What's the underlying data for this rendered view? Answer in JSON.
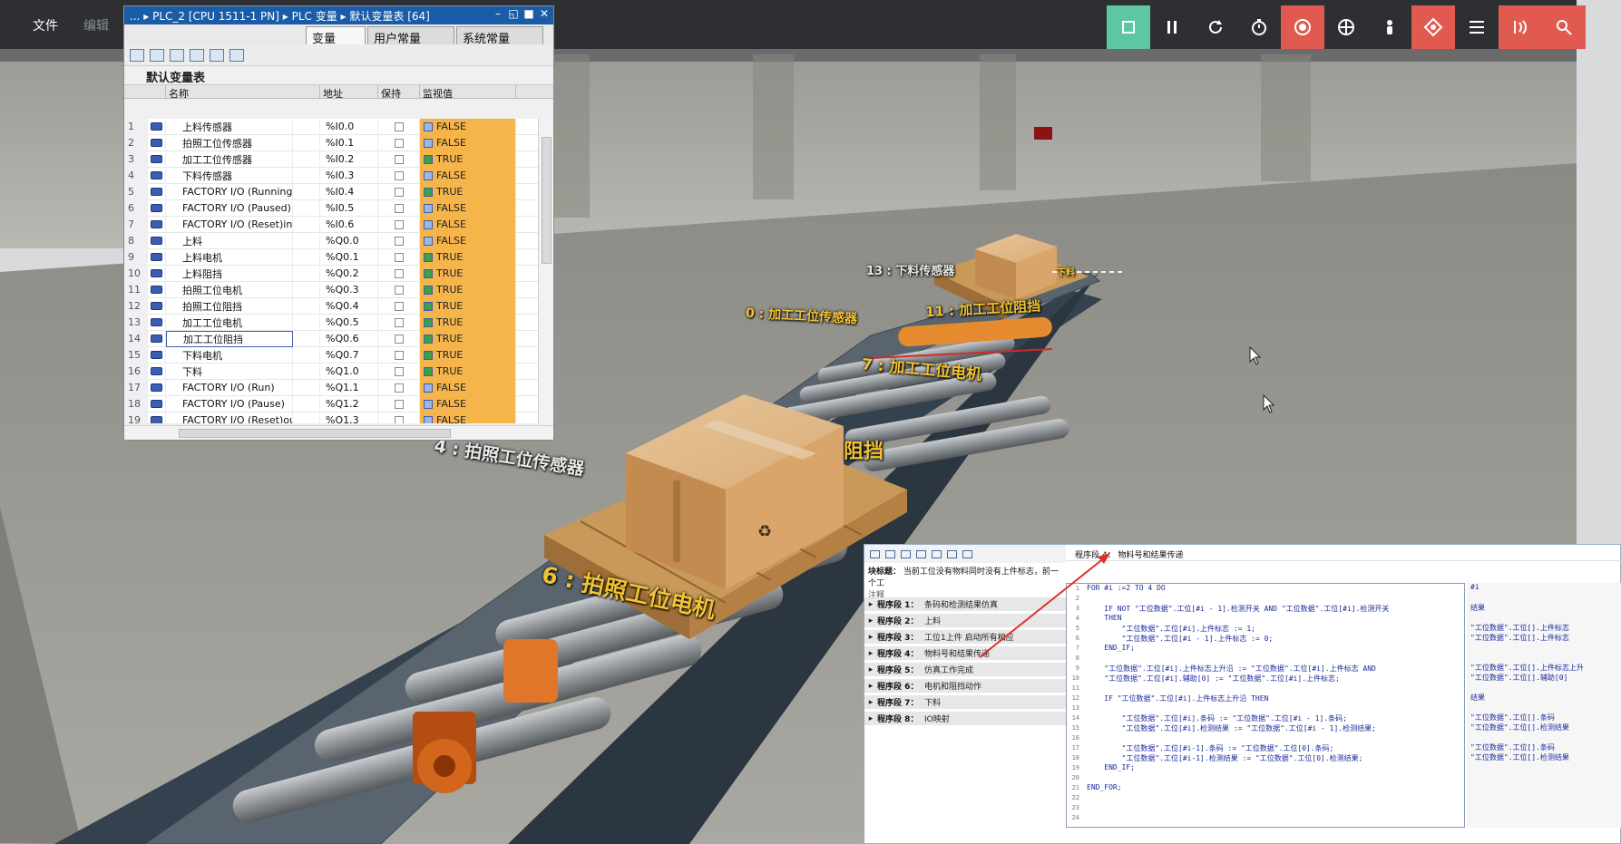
{
  "app": {
    "menu": [
      "文件",
      "编辑"
    ]
  },
  "toolbar": {
    "buttons": [
      {
        "icon": "stop-icon",
        "color": "#5cc7a2"
      },
      {
        "icon": "pause-icon",
        "color": "#2d2f33"
      },
      {
        "icon": "reset-icon",
        "color": "#2d2f33"
      },
      {
        "icon": "timer-icon",
        "color": "#2d2f33"
      },
      {
        "icon": "camera-orbit-icon",
        "color": "#e05a4f"
      },
      {
        "icon": "camera-fly-icon",
        "color": "#2d2f33"
      },
      {
        "icon": "camera-first-person-icon",
        "color": "#2d2f33"
      },
      {
        "icon": "sensor-icon",
        "color": "#e05a4f"
      },
      {
        "icon": "list-icon",
        "color": "#2d2f33"
      },
      {
        "icon": "drivers-icon",
        "color": "#e05a4f"
      },
      {
        "icon": "settings-icon",
        "color": "#e05a4f"
      }
    ]
  },
  "scene_labels": {
    "l13": "13 : 下料传感器",
    "l0": "0 : 加工工位传感器",
    "l11": "11 : 加工工位阻挡",
    "l7": "7 : 加工工位电机",
    "l4": "4 : 拍照工位传感器",
    "l6": "6 : 拍照工位电机",
    "lzd": "阻挡",
    "lxl": "下料"
  },
  "tag_window": {
    "title": "... ▸ PLC_2 [CPU 1511-1 PN] ▸ PLC 变量 ▸ 默认变量表 [64]",
    "tabs": [
      "变量",
      "用户常量",
      "系统常量"
    ],
    "table_title": "默认变量表",
    "columns": [
      "",
      "名称",
      "地址",
      "保持",
      "监视值"
    ],
    "rows": [
      {
        "num": "1",
        "name": "上料传感器",
        "addr": "%I0.0",
        "value": "FALSE"
      },
      {
        "num": "2",
        "name": "拍照工位传感器",
        "addr": "%I0.1",
        "value": "FALSE"
      },
      {
        "num": "3",
        "name": "加工工位传感器",
        "addr": "%I0.2",
        "value": "TRUE"
      },
      {
        "num": "4",
        "name": "下料传感器",
        "addr": "%I0.3",
        "value": "FALSE"
      },
      {
        "num": "5",
        "name": "FACTORY I/O (Running)",
        "addr": "%I0.4",
        "value": "TRUE"
      },
      {
        "num": "6",
        "name": "FACTORY I/O (Paused)",
        "addr": "%I0.5",
        "value": "FALSE"
      },
      {
        "num": "7",
        "name": "FACTORY I/O (Reset)in",
        "addr": "%I0.6",
        "value": "FALSE"
      },
      {
        "num": "8",
        "name": "上料",
        "addr": "%Q0.0",
        "value": "FALSE"
      },
      {
        "num": "9",
        "name": "上料电机",
        "addr": "%Q0.1",
        "value": "TRUE"
      },
      {
        "num": "10",
        "name": "上料阻挡",
        "addr": "%Q0.2",
        "value": "TRUE"
      },
      {
        "num": "11",
        "name": "拍照工位电机",
        "addr": "%Q0.3",
        "value": "TRUE"
      },
      {
        "num": "12",
        "name": "拍照工位阻挡",
        "addr": "%Q0.4",
        "value": "TRUE"
      },
      {
        "num": "13",
        "name": "加工工位电机",
        "addr": "%Q0.5",
        "value": "TRUE"
      },
      {
        "num": "14",
        "name": "加工工位阻挡",
        "addr": "%Q0.6",
        "value": "TRUE"
      },
      {
        "num": "15",
        "name": "下料电机",
        "addr": "%Q0.7",
        "value": "TRUE"
      },
      {
        "num": "16",
        "name": "下料",
        "addr": "%Q1.0",
        "value": "TRUE"
      },
      {
        "num": "17",
        "name": "FACTORY I/O (Run)",
        "addr": "%Q1.1",
        "value": "FALSE"
      },
      {
        "num": "18",
        "name": "FACTORY I/O (Pause)",
        "addr": "%Q1.2",
        "value": "FALSE"
      },
      {
        "num": "19",
        "name": "FACTORY I/O (Reset)out",
        "addr": "%Q1.3",
        "value": "FALSE"
      }
    ],
    "selected_row": "14"
  },
  "program": {
    "block_label": "块标题：",
    "block_desc": "当前工位没有物料同时没有上件标志，前一个工",
    "comment": "注释",
    "segments": [
      {
        "no": "程序段 1：",
        "desc": "条码和检测结果仿真"
      },
      {
        "no": "程序段 2：",
        "desc": "上料"
      },
      {
        "no": "程序段 3：",
        "desc": "工位1上件 启动所有相应"
      },
      {
        "no": "程序段 4：",
        "desc": "物料号和结果传递"
      },
      {
        "no": "程序段 5：",
        "desc": "仿真工作完成"
      },
      {
        "no": "程序段 6：",
        "desc": "电机和阻挡动作"
      },
      {
        "no": "程序段 7：",
        "desc": "下料"
      },
      {
        "no": "程序段 8：",
        "desc": "IO映射"
      }
    ],
    "code_title": "程序段 4：    物料号和结果传递",
    "code_lines": [
      "FOR #i :=2 TO 4 DO",
      "",
      "    IF NOT \"工位数据\".工位[#i - 1].检测开关 AND \"工位数据\".工位[#i].检测开关",
      "    THEN",
      "        \"工位数据\".工位[#i].上件标志 := 1;",
      "        \"工位数据\".工位[#i - 1].上件标志 := 0;",
      "    END_IF;",
      "",
      "    \"工位数据\".工位[#i].上件标志上升沿 := \"工位数据\".工位[#i].上件标志 AND",
      "    \"工位数据\".工位[#i].辅助[0] := \"工位数据\".工位[#i].上件标志;",
      "",
      "    IF \"工位数据\".工位[#i].上件标志上升沿 THEN",
      "",
      "        \"工位数据\".工位[#i].条码 := \"工位数据\".工位[#i - 1].条码;",
      "        \"工位数据\".工位[#i].检测结果 := \"工位数据\".工位[#i - 1].检测结果;",
      "",
      "        \"工位数据\".工位[#i-1].条码 := \"工位数据\".工位[0].条码;",
      "        \"工位数据\".工位[#i-1].检测结果 := \"工位数据\".工位[0].检测结果;",
      "    END_IF;",
      "",
      "END_FOR;"
    ],
    "right_lines": [
      "#i",
      "结果",
      "\"工位数据\".工位[].上件标志",
      "\"工位数据\".工位[].上件标志",
      "\"工位数据\".工位[].上件标志上升",
      "\"工位数据\".工位[].辅助[0]",
      "结果",
      "\"工位数据\".工位[].条码",
      "\"工位数据\".工位[].检测结果",
      "\"工位数据\".工位[].条码",
      "\"工位数据\".工位[].检测结果"
    ]
  }
}
